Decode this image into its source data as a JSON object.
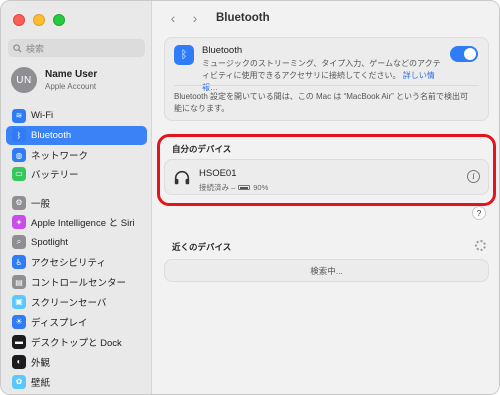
{
  "sidebar": {
    "search_placeholder": "検索",
    "user": {
      "initials": "UN",
      "name": "Name User",
      "subtitle": "Apple Account"
    },
    "items_group1": [
      {
        "label": "Wi-Fi",
        "icon": "wifi-icon",
        "color": "#2f7cf6",
        "glyph": "≋",
        "active": false
      },
      {
        "label": "Bluetooth",
        "icon": "bluetooth-icon",
        "color": "#2f7cf6",
        "glyph": "ᛒ",
        "active": true
      },
      {
        "label": "ネットワーク",
        "icon": "globe-icon",
        "color": "#2f7cf6",
        "glyph": "◍",
        "active": false
      }
    ],
    "items_group2": [
      {
        "label": "バッテリー",
        "icon": "battery-icon",
        "color": "#34c759",
        "glyph": "▭"
      }
    ],
    "items_group3": [
      {
        "label": "一般",
        "icon": "gear-icon",
        "color": "#8e8e93",
        "glyph": "⚙"
      },
      {
        "label": "Apple Intelligence と Siri",
        "icon": "siri-icon",
        "color": "#c94de8",
        "glyph": "✦"
      },
      {
        "label": "Spotlight",
        "icon": "spotlight-icon",
        "color": "#8e8e93",
        "glyph": "⌕"
      },
      {
        "label": "アクセシビリティ",
        "icon": "accessibility-icon",
        "color": "#2f7cf6",
        "glyph": "♿"
      },
      {
        "label": "コントロールセンター",
        "icon": "control-center-icon",
        "color": "#8e8e93",
        "glyph": "▤"
      },
      {
        "label": "スクリーンセーバ",
        "icon": "screensaver-icon",
        "color": "#5ac8fa",
        "glyph": "▣"
      },
      {
        "label": "ディスプレイ",
        "icon": "display-icon",
        "color": "#2f7cf6",
        "glyph": "☀"
      },
      {
        "label": "デスクトップと Dock",
        "icon": "dock-icon",
        "color": "#1c1c1e",
        "glyph": "▬"
      },
      {
        "label": "外観",
        "icon": "appearance-icon",
        "color": "#1c1c1e",
        "glyph": "◐"
      },
      {
        "label": "壁紙",
        "icon": "wallpaper-icon",
        "color": "#5ac8fa",
        "glyph": "✿"
      }
    ]
  },
  "main": {
    "title": "Bluetooth",
    "bluetooth_card": {
      "title": "Bluetooth",
      "description": "ミュージックのストリーミング、タイプ入力、ゲームなどのアクティビティに使用できるアクセサリに接続してください。",
      "link": "詳しい情報…",
      "toggle_on": true,
      "note": "Bluetooth 設定を開いている間は、この Mac は “MacBook Air” という名前で検出可能になります。"
    },
    "my_devices": {
      "title": "自分のデバイス",
      "devices": [
        {
          "name": "HSOE01",
          "status": "接続済み –",
          "battery": "90%"
        }
      ]
    },
    "nearby": {
      "title": "近くのデバイス",
      "searching": "検索中..."
    }
  },
  "colors": {
    "accent": "#2f7cf6",
    "highlight": "#e3141b"
  }
}
